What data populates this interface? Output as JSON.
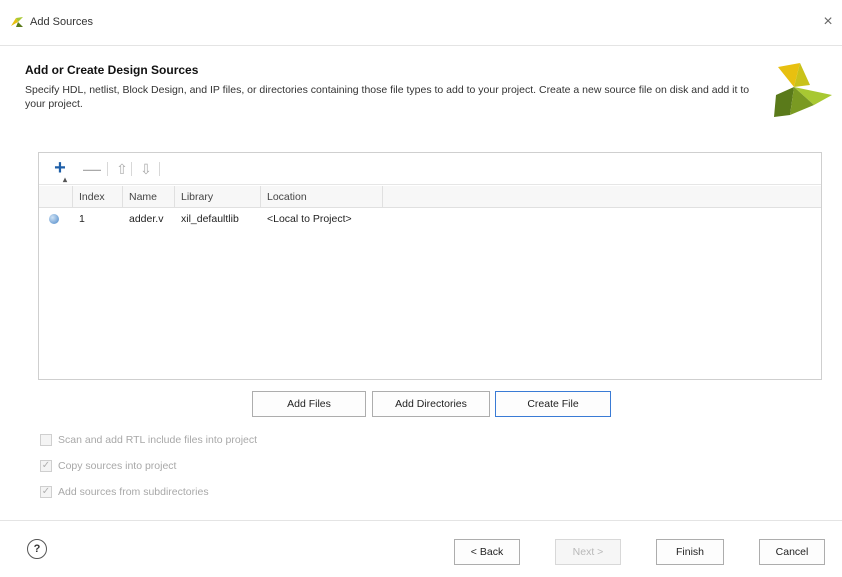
{
  "window": {
    "title": "Add Sources",
    "close_glyph": "×"
  },
  "header": {
    "heading": "Add or Create Design Sources",
    "description": "Specify HDL, netlist, Block Design, and IP files, or directories containing those file types to add to your project. Create a new source file on disk and add it to your project."
  },
  "toolbar": {
    "add_glyph": "+",
    "remove_glyph": "—",
    "up_glyph": "⇧",
    "down_glyph": "⇩"
  },
  "table": {
    "columns": [
      "Index",
      "Name",
      "Library",
      "Location"
    ],
    "rows": [
      {
        "index": "1",
        "name": "adder.v",
        "library": "xil_defaultlib",
        "location": "<Local to Project>"
      }
    ]
  },
  "actions": {
    "add_files": "Add Files",
    "add_directories": "Add Directories",
    "create_file": "Create File"
  },
  "options": {
    "scan": "Scan and add RTL include files into project",
    "copy": "Copy sources into project",
    "recurse": "Add sources from subdirectories",
    "check_glyph": "✓"
  },
  "footer": {
    "help": "?",
    "back": "< Back",
    "next": "Next >",
    "finish": "Finish",
    "cancel": "Cancel"
  },
  "colors": {
    "accent": "#3a7bd5",
    "logo_green_dark": "#5a7a1a",
    "logo_green_light": "#a8c832",
    "logo_yellow": "#e8c010"
  }
}
